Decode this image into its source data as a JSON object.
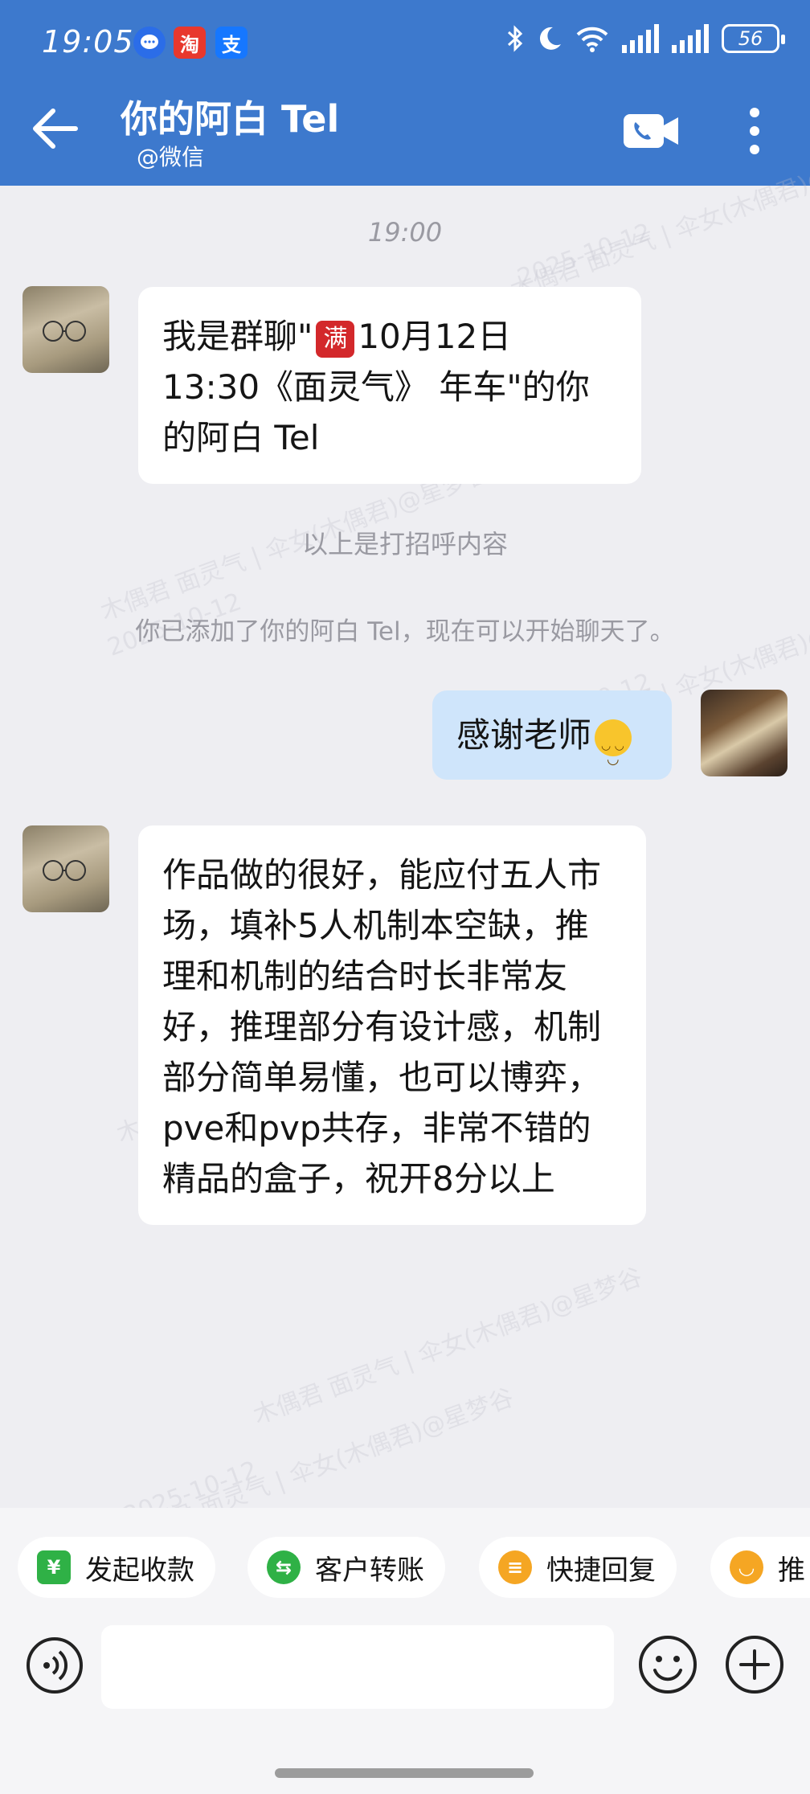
{
  "status_bar": {
    "time": "19:05",
    "battery": "56",
    "notif_taobao": "淘",
    "notif_alipay": "支"
  },
  "header": {
    "title": "你的阿白 Tel",
    "subtitle": "@微信"
  },
  "watermarks": {
    "a": "木偶君 面灵气 | 伞女(木偶君)@星梦谷",
    "b": "2025-10-12"
  },
  "chat": {
    "time_divider": "19:00",
    "msg1_part1": "我是群聊\"",
    "msg1_badge": "满",
    "msg1_part2": "10月12日 13:30《面灵气》 年车\"的你的阿白 Tel",
    "greeting_note": "以上是打招呼内容",
    "added_note": "你已添加了你的阿白 Tel，现在可以开始聊天了。",
    "msg2": "感谢老师",
    "msg3": "作品做的很好，能应付五人市场，填补5人机制本空缺，推理和机制的结合时长非常友好，推理部分有设计感，机制部分简单易懂，也可以博弈，pve和pvp共存，非常不错的精品的盒子，祝开8分以上"
  },
  "quick_actions": [
    {
      "label": "发起收款",
      "icon": "¥",
      "color": "#2fb146"
    },
    {
      "label": "客户转账",
      "icon": "⇆",
      "color": "#2fb146"
    },
    {
      "label": "快捷回复",
      "icon": "≡",
      "color": "#f5a623"
    },
    {
      "label": "推",
      "icon": "◡",
      "color": "#f5a623"
    }
  ],
  "input": {
    "placeholder": ""
  }
}
